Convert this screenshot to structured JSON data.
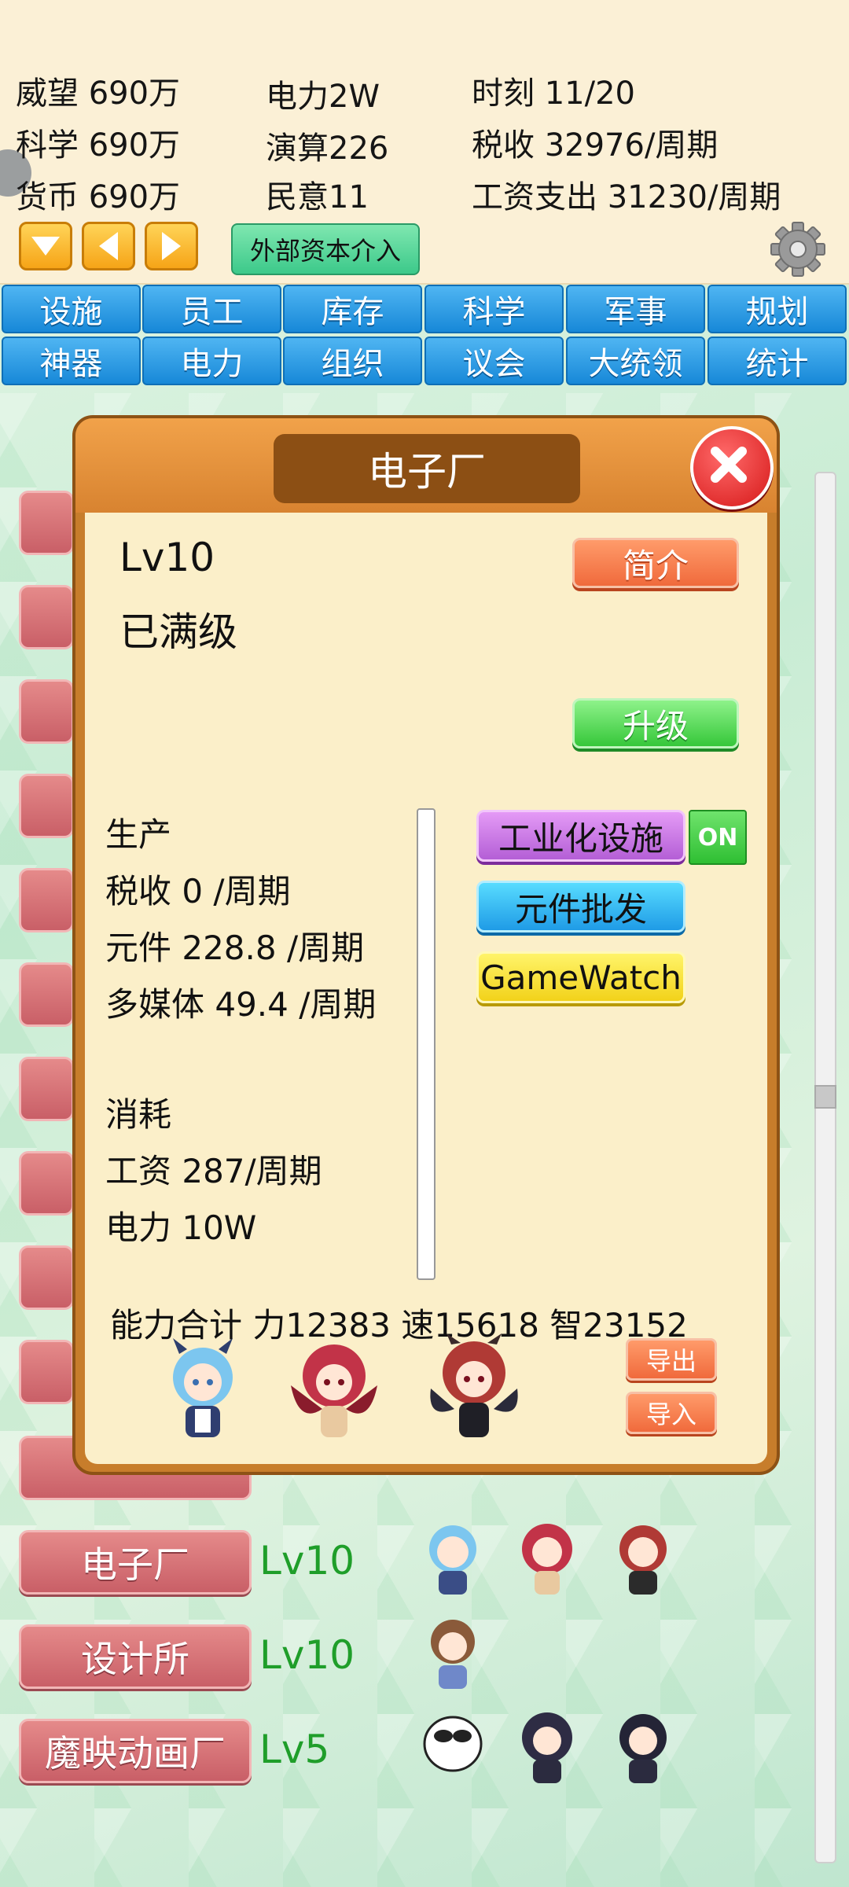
{
  "header": {
    "stats_col1": [
      "威望 690万",
      "科学 690万",
      "货币 690万"
    ],
    "stats_col2": [
      "电力2W",
      "演算226",
      "民意11"
    ],
    "stats_col3": [
      "时刻 11/20",
      "税收 32976/周期",
      "工资支出 31230/周期"
    ],
    "external_capital_label": "外部资本介入",
    "arrow_icons": [
      "arrow-down-icon",
      "arrow-left-icon",
      "arrow-right-icon"
    ]
  },
  "tabs": [
    "设施",
    "员工",
    "库存",
    "科学",
    "军事",
    "规划",
    "神器",
    "电力",
    "组织",
    "议会",
    "大统领",
    "统计"
  ],
  "buildings": [
    {
      "name": "电子厂",
      "level": "Lv10"
    },
    {
      "name": "设计所",
      "level": "Lv10"
    },
    {
      "name": "魔映动画厂",
      "level": "Lv5"
    }
  ],
  "modal": {
    "title": "电子厂",
    "level": "Lv10",
    "max_status": "已满级",
    "intro_label": "简介",
    "upgrade_label": "升级",
    "production_heading": "生产",
    "production_lines": [
      "税收 0 /周期",
      "元件 228.8 /周期",
      "多媒体 49.4 /周期"
    ],
    "consumption_heading": "消耗",
    "consumption_lines": [
      "工资 287/周期",
      "电力 10W"
    ],
    "ability_summary": "能力合计 力12383 速15618 智23152",
    "industrial_label": "工业化设施",
    "industrial_toggle": "ON",
    "wholesale_label": "元件批发",
    "gamewatch_label": "GameWatch",
    "export_label": "导出",
    "import_label": "导入"
  },
  "colors": {
    "tab_blue": "#1788d8",
    "level_green": "#1f9e2a",
    "building_red": "#c95f67",
    "modal_wood": "#c77d2b",
    "modal_panel": "#fbefc9"
  }
}
